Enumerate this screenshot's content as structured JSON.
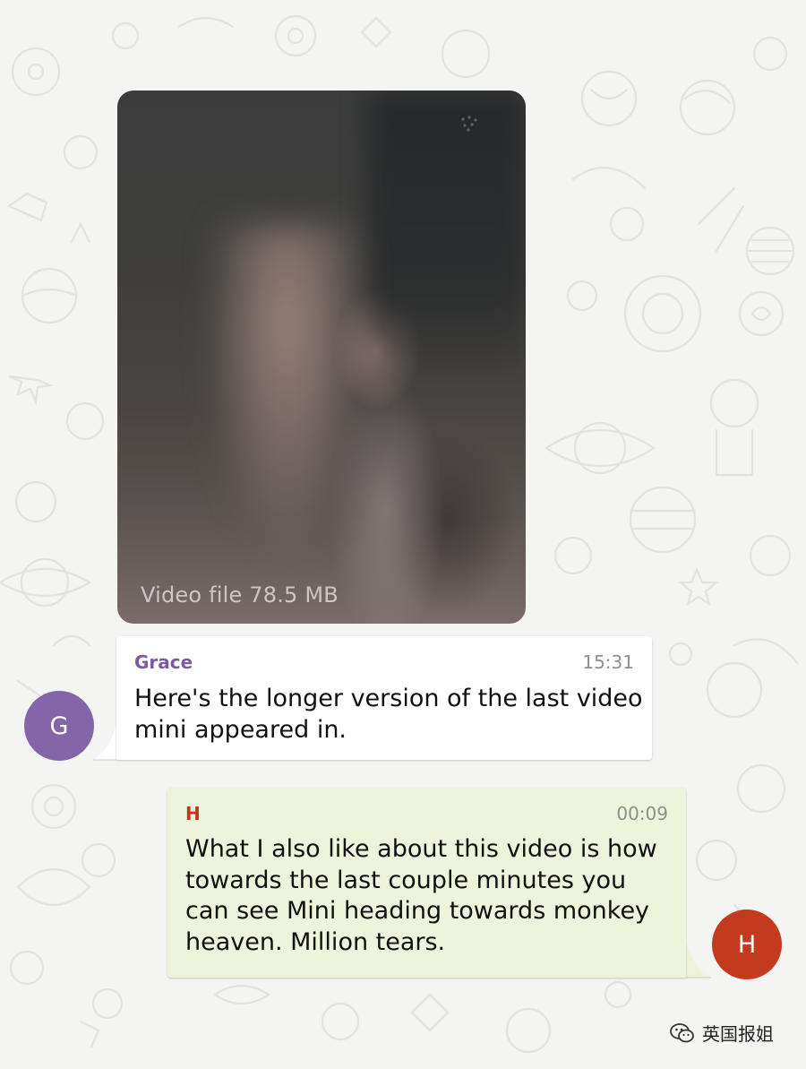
{
  "colors": {
    "grace_name": "#7e5aa3",
    "grace_avatar": "#8466a8",
    "h_name": "#c0361d",
    "h_avatar": "#c43a1f",
    "h_bubble": "#eef4dc"
  },
  "video": {
    "caption": "Video file 78.5 MB"
  },
  "messages": [
    {
      "sender": "Grace",
      "time": "15:31",
      "text": "Here's the longer version of the last video\nmini appeared in.",
      "avatar_letter": "G"
    },
    {
      "sender": "H",
      "time": "00:09",
      "text": "What I also like about this video is how\ntowards the last couple minutes you\ncan see Mini heading towards monkey\nheaven. Million tears.",
      "avatar_letter": "H"
    }
  ],
  "watermark": {
    "icon": "wechat-icon",
    "text": "英国报姐"
  }
}
